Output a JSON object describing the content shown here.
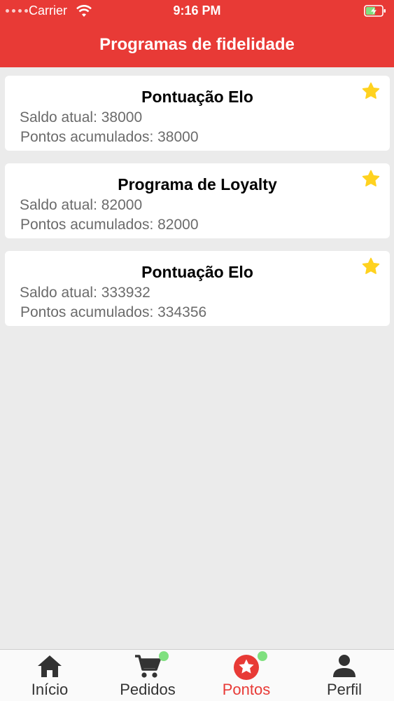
{
  "status_bar": {
    "carrier": "Carrier",
    "time": "9:16 PM"
  },
  "header": {
    "title": "Programas de fidelidade"
  },
  "cards": [
    {
      "title": "Pontuação Elo",
      "balance": "Saldo atual: 38000",
      "accumulated": "Pontos acumulados: 38000"
    },
    {
      "title": "Programa de Loyalty",
      "balance": "Saldo atual: 82000",
      "accumulated": "Pontos acumulados: 82000"
    },
    {
      "title": "Pontuação Elo",
      "balance": "Saldo atual: 333932",
      "accumulated": "Pontos acumulados: 334356"
    }
  ],
  "tabbar": {
    "tabs": [
      {
        "label": "Início",
        "icon": "home-icon",
        "active": false,
        "badge": false
      },
      {
        "label": "Pedidos",
        "icon": "cart-icon",
        "active": false,
        "badge": true
      },
      {
        "label": "Pontos",
        "icon": "star-circle-icon",
        "active": true,
        "badge": true
      },
      {
        "label": "Perfil",
        "icon": "person-icon",
        "active": false,
        "badge": false
      }
    ]
  },
  "colors": {
    "primary": "#e83a36",
    "star": "#ffd21f",
    "badge": "#7fe07f",
    "background": "#ebebeb"
  }
}
